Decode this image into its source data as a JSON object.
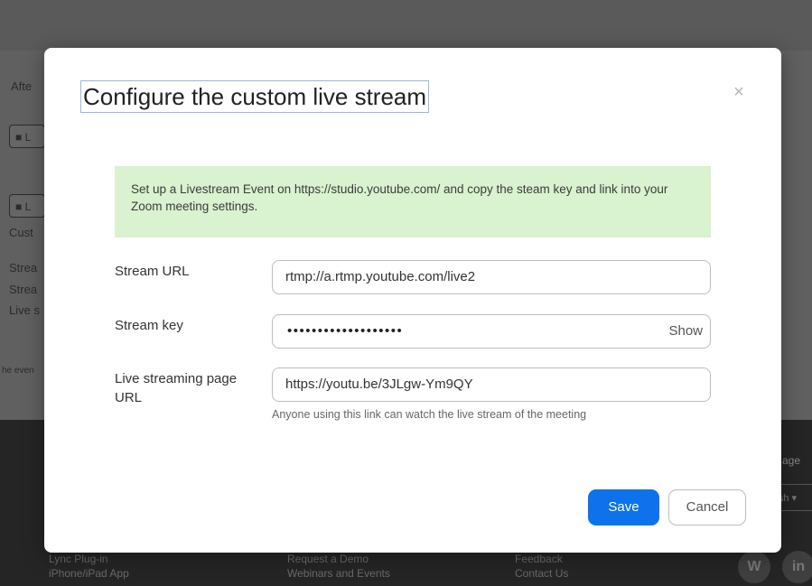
{
  "background": {
    "page_texts": [
      "Afte",
      "Cust",
      "Strea",
      "Strea",
      "Live s",
      "he even"
    ],
    "buttons": [
      "L",
      "L"
    ],
    "footer_links": [
      "Lync Plug-in",
      "iPhone/iPad App",
      "Request a Demo",
      "Webinars and Events",
      "Feedback",
      "Contact Us"
    ],
    "language_label": "age",
    "language_value": "lish ▾",
    "social_icons": [
      "W",
      "in"
    ]
  },
  "modal": {
    "title": "Configure the custom live stream",
    "close_glyph": "×",
    "notice": "Set up a Livestream Event on https://studio.youtube.com/ and copy the steam key and link into your Zoom meeting settings.",
    "fields": {
      "stream_url": {
        "label": "Stream URL",
        "value": "rtmp://a.rtmp.youtube.com/live2"
      },
      "stream_key": {
        "label": "Stream key",
        "masked_value": "•••••••••••••••••••",
        "show_label": "Show"
      },
      "live_page_url": {
        "label": "Live streaming page URL",
        "value": "https://youtu.be/3JLgw-Ym9QY",
        "helper": "Anyone using this link can watch the live stream of the meeting"
      }
    },
    "save_label": "Save",
    "cancel_label": "Cancel"
  },
  "colors": {
    "primary_button": "#0e72ed",
    "notice_background": "#d9f2cf",
    "overlay": "#606060"
  }
}
